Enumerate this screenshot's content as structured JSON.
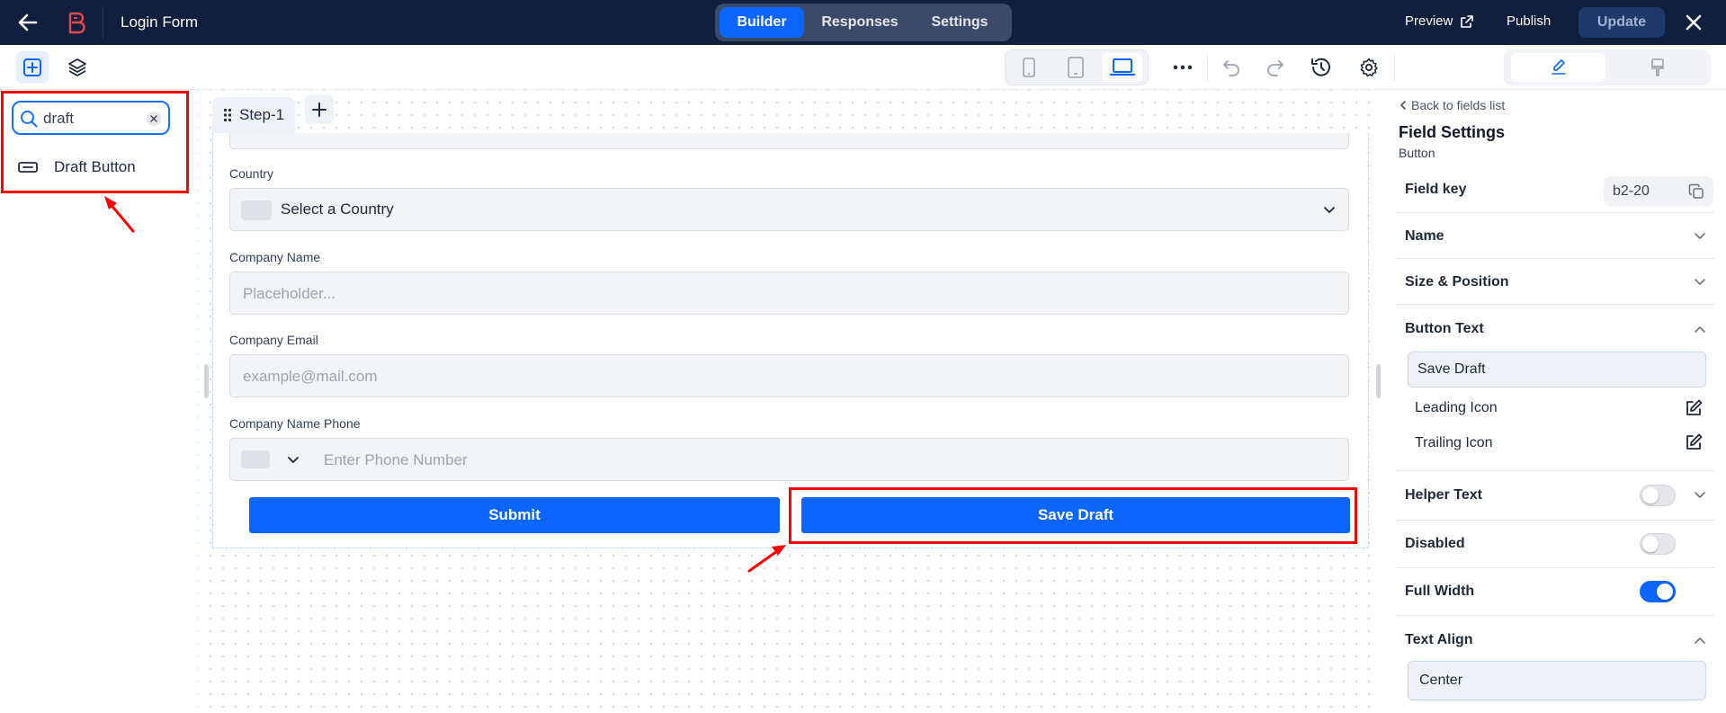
{
  "app": {
    "form_title": "Login Form",
    "tabs": [
      {
        "label": "Builder",
        "active": true
      },
      {
        "label": "Responses",
        "active": false
      },
      {
        "label": "Settings",
        "active": false
      }
    ],
    "preview_label": "Preview",
    "publish_label": "Publish",
    "update_label": "Update"
  },
  "colors": {
    "topbar_bg": "#0f1f3d",
    "accent": "#0a66ff",
    "highlight_red": "#ff0000",
    "logo_red": "#e5484d"
  },
  "toolbar": {
    "left_tools": [
      "add-field-icon",
      "layers-icon"
    ],
    "devices": [
      "mobile-icon",
      "tablet-icon",
      "desktop-icon"
    ],
    "active_device": "desktop",
    "actions": [
      "more-icon",
      "undo-icon",
      "redo-icon",
      "history-icon",
      "settings-icon"
    ],
    "modes": [
      "edit-icon",
      "style-brush-icon"
    ],
    "active_mode": "edit"
  },
  "left_panel": {
    "search_value": "draft",
    "results": [
      {
        "label": "Draft Button",
        "icon": "button-field-icon"
      }
    ]
  },
  "canvas": {
    "step_label": "Step-1",
    "fields": [
      {
        "label": "Country",
        "type": "select",
        "value": "Select a Country"
      },
      {
        "label": "Company Name",
        "type": "text",
        "placeholder": "Placeholder..."
      },
      {
        "label": "Company Email",
        "type": "email",
        "placeholder": "example@mail.com"
      },
      {
        "label": "Company Name Phone",
        "type": "phone",
        "placeholder": "Enter Phone Number"
      }
    ],
    "buttons": {
      "submit": "Submit",
      "save_draft": "Save Draft"
    }
  },
  "right_panel": {
    "back_label": "Back to fields list",
    "title": "Field Settings",
    "subtitle": "Button",
    "field_key_label": "Field key",
    "field_key_value": "b2-20",
    "sections": {
      "name": "Name",
      "size_position": "Size & Position",
      "button_text": "Button Text",
      "helper_text": "Helper Text",
      "disabled": "Disabled",
      "full_width": "Full Width",
      "text_align": "Text Align"
    },
    "button_text_value": "Save Draft",
    "leading_icon_label": "Leading Icon",
    "trailing_icon_label": "Trailing Icon",
    "helper_text_enabled": false,
    "disabled_enabled": false,
    "full_width_enabled": true,
    "text_align_value": "Center"
  }
}
